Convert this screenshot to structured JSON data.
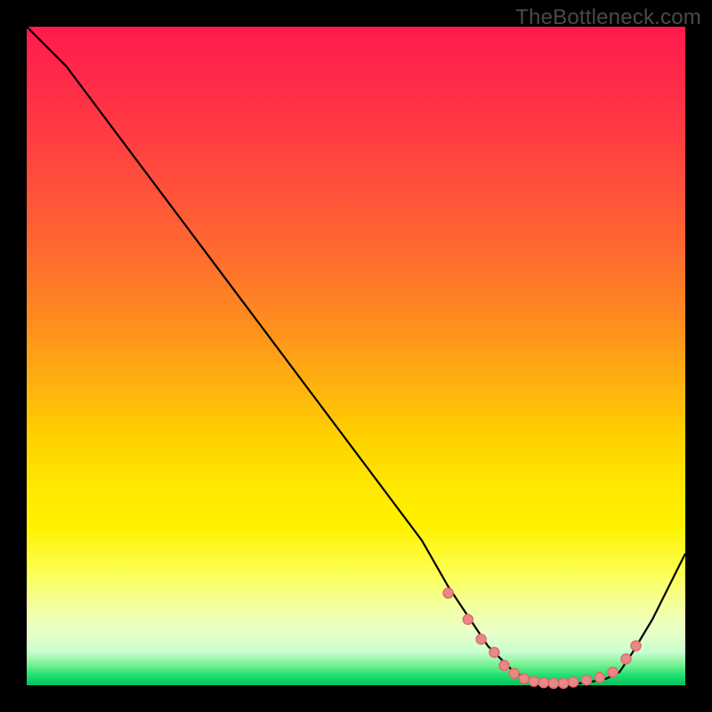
{
  "watermark": "TheBottleneck.com",
  "colors": {
    "curve_stroke": "#000000",
    "marker_stroke": "#e06b6b",
    "marker_fill": "#e98888"
  },
  "chart_data": {
    "type": "line",
    "title": "",
    "xlabel": "",
    "ylabel": "",
    "xlim": [
      0,
      100
    ],
    "ylim": [
      0,
      100
    ],
    "grid": false,
    "series": [
      {
        "name": "bottleneck-curve",
        "x": [
          0,
          6,
          12,
          18,
          24,
          30,
          36,
          42,
          48,
          54,
          60,
          64,
          68,
          70,
          72,
          74,
          76,
          78,
          80,
          82,
          84,
          86,
          88,
          90,
          92,
          95,
          98,
          100
        ],
        "values": [
          100,
          94,
          86,
          78,
          70,
          62,
          54,
          46,
          38,
          30,
          22,
          15,
          9,
          6,
          4,
          2,
          1,
          0.5,
          0.3,
          0.2,
          0.3,
          0.6,
          1,
          2,
          5,
          10,
          16,
          20
        ]
      }
    ],
    "markers": {
      "name": "optimal-range",
      "x": [
        64,
        67,
        69,
        71,
        72.5,
        74,
        75.5,
        77,
        78.5,
        80,
        81.5,
        83,
        85,
        87,
        89,
        91,
        92.5
      ],
      "values": [
        14,
        10,
        7,
        5,
        3,
        1.8,
        1.0,
        0.6,
        0.4,
        0.3,
        0.3,
        0.5,
        0.8,
        1.2,
        2.0,
        4.0,
        6.0
      ]
    }
  }
}
